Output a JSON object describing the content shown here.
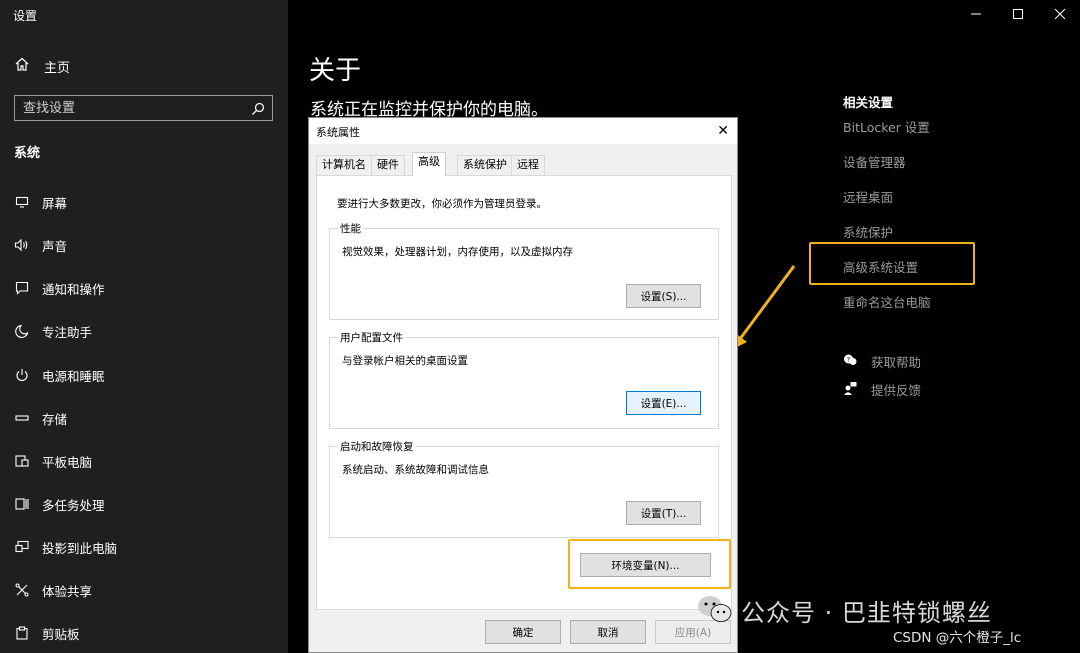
{
  "app": {
    "title": "设置"
  },
  "sidebar": {
    "home_label": "主页",
    "search_placeholder": "查找设置",
    "section_title": "系统",
    "items": [
      {
        "label": "屏幕",
        "icon": "monitor-icon"
      },
      {
        "label": "声音",
        "icon": "speaker-icon"
      },
      {
        "label": "通知和操作",
        "icon": "notification-icon"
      },
      {
        "label": "专注助手",
        "icon": "moon-icon"
      },
      {
        "label": "电源和睡眠",
        "icon": "power-icon"
      },
      {
        "label": "存储",
        "icon": "storage-icon"
      },
      {
        "label": "平板电脑",
        "icon": "tablet-icon"
      },
      {
        "label": "多任务处理",
        "icon": "multitask-icon"
      },
      {
        "label": "投影到此电脑",
        "icon": "project-icon"
      },
      {
        "label": "体验共享",
        "icon": "share-icon"
      },
      {
        "label": "剪贴板",
        "icon": "clipboard-icon"
      }
    ]
  },
  "main": {
    "heading": "关于",
    "status": "系统正在监控并保护你的电脑。"
  },
  "related": {
    "title": "相关设置",
    "links": [
      "BitLocker 设置",
      "设备管理器",
      "远程桌面",
      "系统保护",
      "高级系统设置",
      "重命名这台电脑"
    ],
    "help": [
      {
        "label": "获取帮助",
        "icon": "help-icon"
      },
      {
        "label": "提供反馈",
        "icon": "feedback-icon"
      }
    ]
  },
  "dialog": {
    "title": "系统属性",
    "tabs": [
      "计算机名",
      "硬件",
      "高级",
      "系统保护",
      "远程"
    ],
    "active_tab": "高级",
    "admin_note": "要进行大多数更改，你必须作为管理员登录。",
    "groups": [
      {
        "title": "性能",
        "desc": "视觉效果，处理器计划，内存使用，以及虚拟内存",
        "button": "设置(S)..."
      },
      {
        "title": "用户配置文件",
        "desc": "与登录帐户相关的桌面设置",
        "button": "设置(E)..."
      },
      {
        "title": "启动和故障恢复",
        "desc": "系统启动、系统故障和调试信息",
        "button": "设置(T)..."
      }
    ],
    "env_button": "环境变量(N)...",
    "ok": "确定",
    "cancel": "取消",
    "apply": "应用(A)"
  },
  "watermarks": {
    "wechat": "公众号 · 巴韭特锁螺丝",
    "csdn": "CSDN @六个橙子_lc"
  },
  "colors": {
    "sidebar_bg": "#1f1f1f",
    "main_bg": "#000000",
    "highlight": "#f2b21b",
    "link_muted": "#9a9a9a"
  }
}
